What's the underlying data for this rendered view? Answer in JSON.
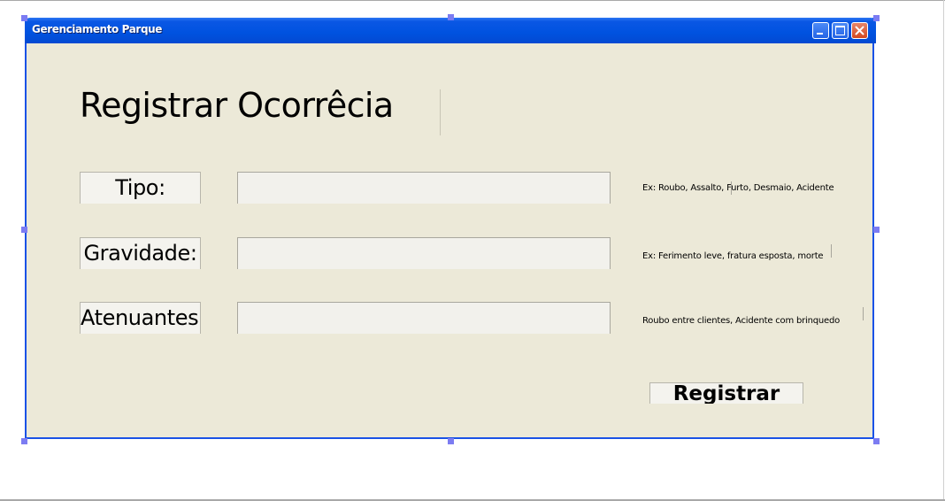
{
  "window": {
    "title": "Gerenciamento Parque",
    "controls": {
      "minimize_icon": "minimize-icon",
      "maximize_icon": "maximize-icon",
      "close_icon": "close-icon"
    }
  },
  "form": {
    "heading": "Registrar Ocorrêcia",
    "fields": [
      {
        "label": "Tipo:",
        "value": "",
        "hint": "Ex: Roubo, Assalto, Furto, Desmaio, Acidente"
      },
      {
        "label": "Gravidade:",
        "value": "",
        "hint": "Ex: Ferimento leve, fratura esposta, morte"
      },
      {
        "label": "Atenuantes:",
        "value": "",
        "hint": "Roubo entre clientes, Acidente com brinquedo"
      }
    ],
    "submit_label": "Registrar"
  },
  "colors": {
    "titlebar": "#0052e0",
    "window_border": "#1a52e6",
    "panel_background": "#ece9d8",
    "selection_handle": "#7c7cf2"
  }
}
